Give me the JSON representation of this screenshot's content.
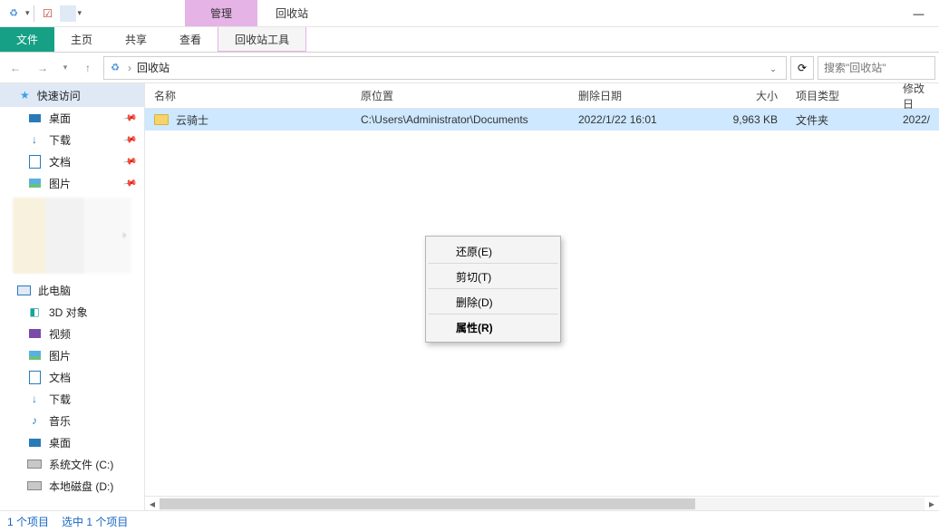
{
  "window": {
    "title": "回收站"
  },
  "ribbon": {
    "contextual_group": "管理",
    "tabs": {
      "file": "文件",
      "home": "主页",
      "share": "共享",
      "view": "查看",
      "tools": "回收站工具"
    }
  },
  "address": {
    "location": "回收站",
    "separator": "›"
  },
  "search": {
    "placeholder": "搜索\"回收站\""
  },
  "sidebar": {
    "quick_access": "快速访问",
    "items": [
      {
        "label": "桌面",
        "icon": "desktop",
        "pinned": true
      },
      {
        "label": "下载",
        "icon": "download",
        "pinned": true
      },
      {
        "label": "文档",
        "icon": "doc",
        "pinned": true
      },
      {
        "label": "图片",
        "icon": "pic",
        "pinned": true
      }
    ],
    "this_pc": "此电脑",
    "pc_items": [
      {
        "label": "3D 对象",
        "icon": "cube"
      },
      {
        "label": "视频",
        "icon": "video"
      },
      {
        "label": "图片",
        "icon": "pic"
      },
      {
        "label": "文档",
        "icon": "doc"
      },
      {
        "label": "下载",
        "icon": "download"
      },
      {
        "label": "音乐",
        "icon": "music"
      },
      {
        "label": "桌面",
        "icon": "desktop"
      },
      {
        "label": "系统文件 (C:)",
        "icon": "drive"
      },
      {
        "label": "本地磁盘 (D:)",
        "icon": "drive"
      }
    ]
  },
  "columns": {
    "name": "名称",
    "orig": "原位置",
    "deleted": "删除日期",
    "size": "大小",
    "type": "项目类型",
    "modified": "修改日"
  },
  "rows": [
    {
      "name": "云骑士",
      "orig": "C:\\Users\\Administrator\\Documents",
      "deleted": "2022/1/22 16:01",
      "size": "9,963 KB",
      "type": "文件夹",
      "modified": "2022/"
    }
  ],
  "context_menu": [
    {
      "label": "还原(E)",
      "sep": true
    },
    {
      "label": "剪切(T)",
      "sep": true
    },
    {
      "label": "删除(D)",
      "sep": true
    },
    {
      "label": "属性(R)",
      "bold": true
    }
  ],
  "status": {
    "count": "1 个项目",
    "selected": "选中 1 个项目"
  }
}
